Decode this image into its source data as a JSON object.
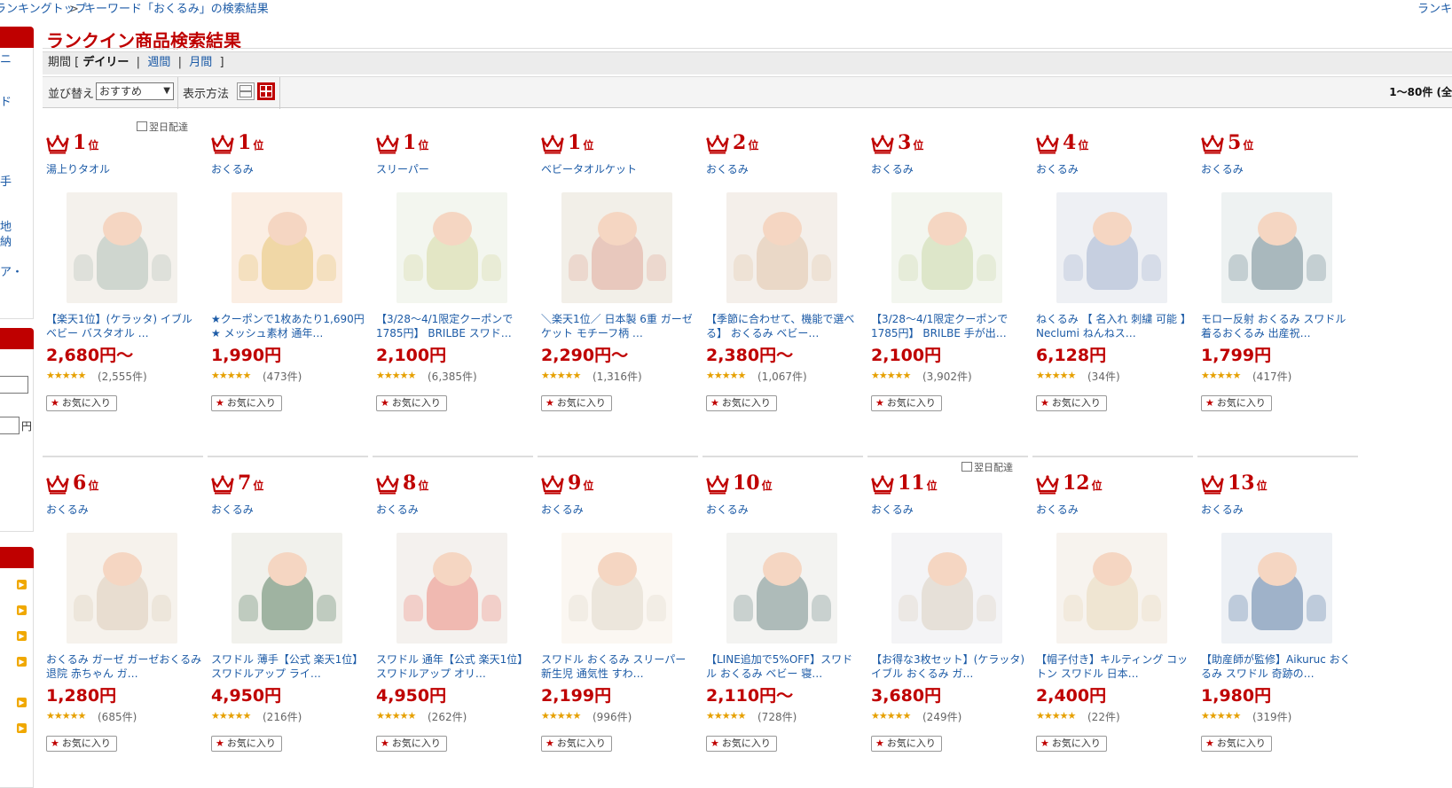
{
  "breadcrumb": {
    "items": [
      "ランキングトップ",
      "キーワード「おくるみ」の検索結果"
    ],
    "separator": ">",
    "right_link": "ランキ"
  },
  "sidebar": {
    "texts": [
      "ニ",
      "ド",
      "手",
      "地",
      "納",
      "ア・"
    ],
    "yen": "円"
  },
  "page_title": "ランクイン商品検索結果",
  "period": {
    "label": "期間",
    "open_bracket": "[",
    "close_bracket": "]",
    "current": "デイリー",
    "sep": "|",
    "weekly": "週間",
    "monthly": "月間"
  },
  "sort": {
    "label": "並び替え",
    "selected": "おすすめ",
    "view_label": "表示方法"
  },
  "result_count": "1〜80件 (全",
  "labels": {
    "rank_unit": "位",
    "next_day": "翌日配達",
    "favorite": "お気に入り",
    "stars": "★★★★★"
  },
  "products": [
    {
      "rank": "1",
      "next_day": true,
      "category": "湯上りタオル",
      "name": "【楽天1位】(ケラッタ) イブル ベビー バスタオル …",
      "price": "2,680円〜",
      "reviews": "(2,555件)",
      "bg": "#f4f1ec",
      "wrap": "#cfd6cf"
    },
    {
      "rank": "1",
      "next_day": false,
      "category": "おくるみ",
      "name": "★クーポンで1枚あたり1,690円★ メッシュ素材 通年…",
      "price": "1,990円",
      "reviews": "(473件)",
      "bg": "#fbeee3",
      "wrap": "#f0d7a6"
    },
    {
      "rank": "1",
      "next_day": false,
      "category": "スリーパー",
      "name": "【3/28〜4/1限定クーポンで1785円】 BRILBE スワド…",
      "price": "2,100円",
      "reviews": "(6,385件)",
      "bg": "#f3f6ef",
      "wrap": "#e3e6c5"
    },
    {
      "rank": "1",
      "next_day": false,
      "category": "ベビータオルケット",
      "name": "＼楽天1位／ 日本製 6重 ガーゼケット モチーフ柄 …",
      "price": "2,290円〜",
      "reviews": "(1,316件)",
      "bg": "#f2efe8",
      "wrap": "#e8c8bd"
    },
    {
      "rank": "2",
      "next_day": false,
      "category": "おくるみ",
      "name": "【季節に合わせて、機能で選べる】 おくるみ ベビー…",
      "price": "2,380円〜",
      "reviews": "(1,067件)",
      "bg": "#f4efea",
      "wrap": "#ead8c7"
    },
    {
      "rank": "3",
      "next_day": false,
      "category": "おくるみ",
      "name": "【3/28〜4/1限定クーポンで1785円】 BRILBE 手が出…",
      "price": "2,100円",
      "reviews": "(3,902件)",
      "bg": "#f3f6ef",
      "wrap": "#dde6c9"
    },
    {
      "rank": "4",
      "next_day": false,
      "category": "おくるみ",
      "name": "ねくるみ 【 名入れ 刺繍 可能 】 Neclumi ねんねス…",
      "price": "6,128円",
      "reviews": "(34件)",
      "bg": "#eef0f4",
      "wrap": "#c6cfe0"
    },
    {
      "rank": "5",
      "next_day": false,
      "category": "おくるみ",
      "name": "モロー反射 おくるみ スワドル 着るおくるみ 出産祝…",
      "price": "1,799円",
      "reviews": "(417件)",
      "bg": "#eef2f2",
      "wrap": "#a9b8bd"
    },
    {
      "rank": "6",
      "next_day": false,
      "category": "おくるみ",
      "name": "おくるみ ガーゼ ガーゼおくるみ 退院 赤ちゃん ガ…",
      "price": "1,280円",
      "reviews": "(685件)",
      "bg": "#f6f2ec",
      "wrap": "#e8ddd0"
    },
    {
      "rank": "7",
      "next_day": false,
      "category": "おくるみ",
      "name": "スワドル 薄手【公式 楽天1位】スワドルアップ ライ…",
      "price": "4,950円",
      "reviews": "(216件)",
      "bg": "#f1f1ec",
      "wrap": "#9fb3a1"
    },
    {
      "rank": "8",
      "next_day": false,
      "category": "おくるみ",
      "name": "スワドル 通年【公式 楽天1位】スワドルアップ オリ…",
      "price": "4,950円",
      "reviews": "(262件)",
      "bg": "#f4f1ee",
      "wrap": "#f0b9b1"
    },
    {
      "rank": "9",
      "next_day": false,
      "category": "おくるみ",
      "name": "スワドル おくるみ スリーパー 新生児 通気性 すわ…",
      "price": "2,199円",
      "reviews": "(996件)",
      "bg": "#fbf7f2",
      "wrap": "#ece6dc"
    },
    {
      "rank": "10",
      "next_day": false,
      "category": "おくるみ",
      "name": "【LINE追加で5%OFF】スワドル おくるみ ベビー 寝…",
      "price": "2,110円〜",
      "reviews": "(728件)",
      "bg": "#f3f3f1",
      "wrap": "#aebbb9"
    },
    {
      "rank": "11",
      "next_day": true,
      "category": "おくるみ",
      "name": "【お得な3枚セット】(ケラッタ) イブル おくるみ ガ…",
      "price": "3,680円",
      "reviews": "(249件)",
      "bg": "#f4f4f6",
      "wrap": "#e6e0d8"
    },
    {
      "rank": "12",
      "next_day": false,
      "category": "おくるみ",
      "name": "【帽子付き】キルティング コットン スワドル 日本…",
      "price": "2,400円",
      "reviews": "(22件)",
      "bg": "#f7f3ee",
      "wrap": "#efe5d2"
    },
    {
      "rank": "13",
      "next_day": false,
      "category": "おくるみ",
      "name": "【助産師が監修】Aikuruc おくるみ スワドル 奇跡の…",
      "price": "1,980円",
      "reviews": "(319件)",
      "bg": "#eef1f5",
      "wrap": "#9fb2c9"
    }
  ],
  "colors": {
    "brand_red": "#bf0000",
    "link_blue": "#1b5aa6",
    "star": "#e6a000"
  }
}
